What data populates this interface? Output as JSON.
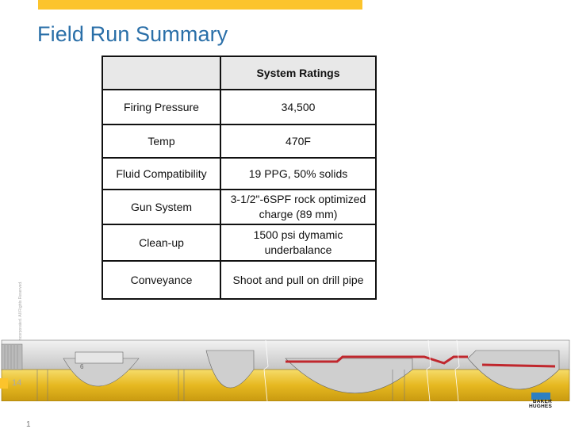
{
  "slide": {
    "title": "Field Run Summary",
    "page_number": "14",
    "footer_mark": "1",
    "copyright": "© 2014 Baker Hughes Incorporated. All Rights Reserved."
  },
  "table": {
    "header": [
      "",
      "System Ratings"
    ],
    "rows": [
      {
        "label": "Firing Pressure",
        "value": "34,500"
      },
      {
        "label": "Temp",
        "value": "470F"
      },
      {
        "label": "Fluid Compatibility",
        "value": "19 PPG, 50% solids"
      },
      {
        "label": "Gun System",
        "value": "3-1/2\"-6SPF rock optimized charge (89 mm)"
      },
      {
        "label": "Clean-up",
        "value": "1500 psi dymamic underbalance"
      },
      {
        "label": "Conveyance",
        "value": "Shoot and pull on drill pipe"
      }
    ]
  },
  "illustration": {
    "name": "perforating gun assembly cutaway",
    "label": "6"
  },
  "logo": {
    "line1": "BAKER",
    "line2": "HUGHES"
  },
  "colors": {
    "accent_yellow": "#fcc42c",
    "title_blue": "#2a6fa8",
    "logo_blue": "#2d7fc1",
    "gun_red": "#c0272d"
  }
}
